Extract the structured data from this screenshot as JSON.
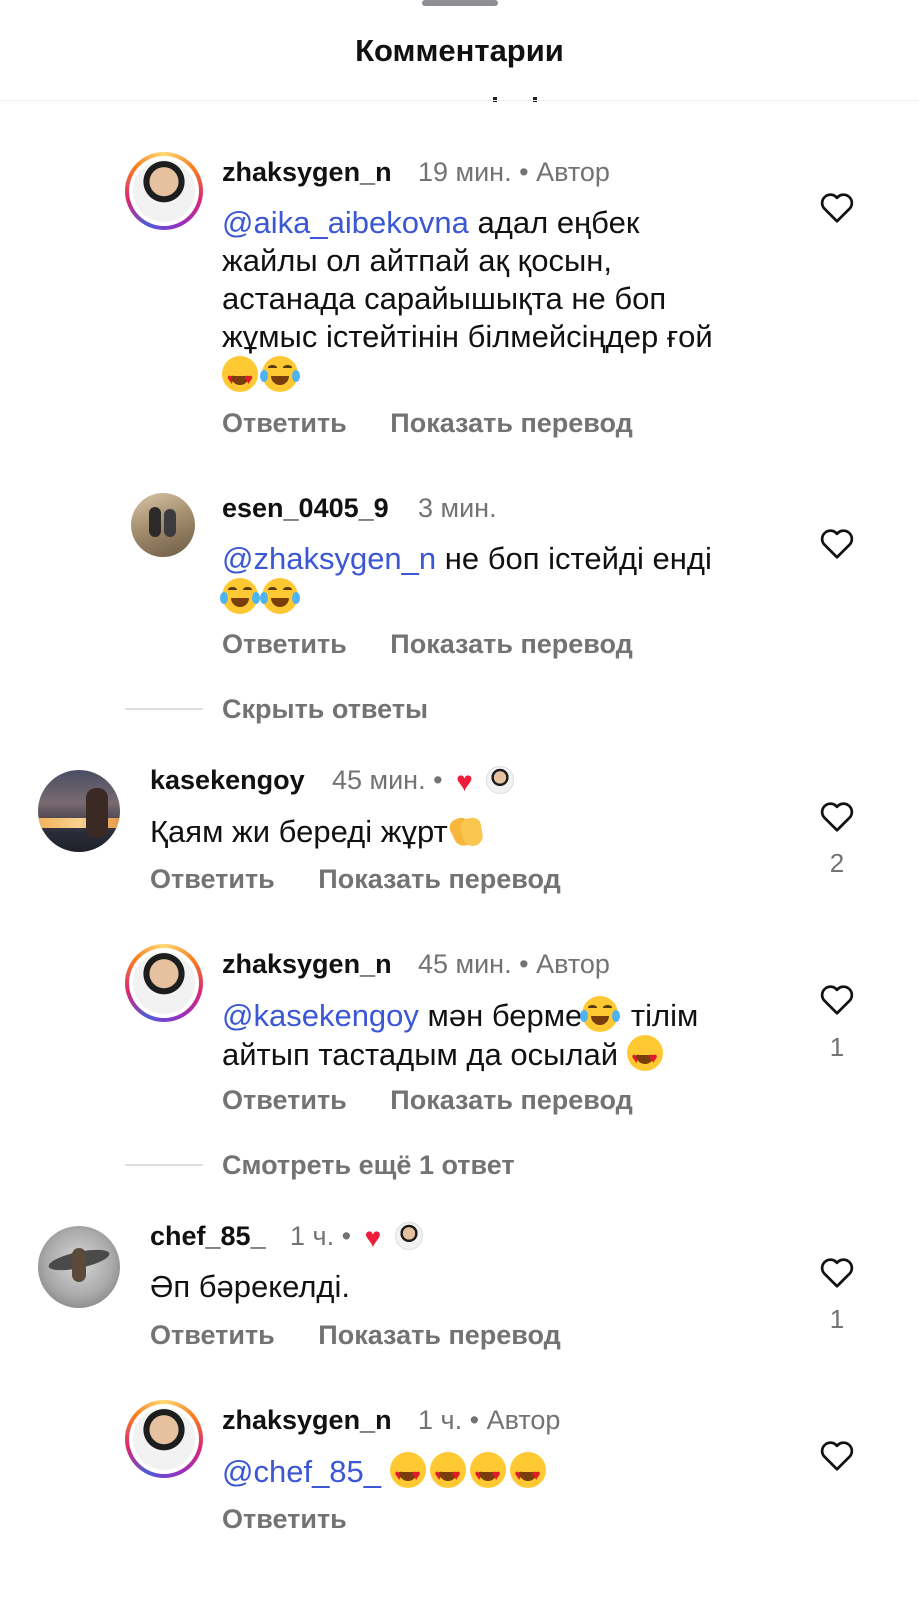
{
  "header": {
    "title": "Комментарии"
  },
  "threads": [
    {
      "username": "zhaksygen_n",
      "time": "19 мин.",
      "author_tag": "• Автор",
      "mention": "@aika_aibekovna",
      "text_lines": [
        "адал еңбек",
        "жайлы ол айтпай ақ қосын,",
        "астанада сарайышықта не боп",
        "жұмыс істейтінін білмейсіңдер ғой"
      ],
      "emoji": [
        "heart-eyes",
        "joy"
      ],
      "reply_label": "Ответить",
      "translate_label": "Показать перевод",
      "like_count": ""
    },
    {
      "username": "esen_0405_9",
      "time": "3 мин.",
      "mention": "@zhaksygen_n",
      "text_lines": [
        "не боп істейді  енді"
      ],
      "emoji": [
        "joy",
        "joy"
      ],
      "reply_label": "Ответить",
      "translate_label": "Показать перевод",
      "like_count": ""
    },
    {
      "divider_label": "Скрыть ответы"
    },
    {
      "username": "kasekengoy",
      "time": "45 мин. •",
      "text_lines": [
        "Қаям жи береді жұрт"
      ],
      "emoji": [
        "clap"
      ],
      "reply_label": "Ответить",
      "translate_label": "Показать перевод",
      "like_count": "2"
    },
    {
      "username": "zhaksygen_n",
      "time": "45 мин.",
      "author_tag": "• Автор",
      "mention": "@kasekengoy",
      "text_lines": [
        "мән берме",
        "тілім",
        "айтып тастадым да осылай"
      ],
      "emoji": [
        "joy",
        "heart-eyes"
      ],
      "reply_label": "Ответить",
      "translate_label": "Показать перевод",
      "like_count": "1"
    },
    {
      "divider_label": "Смотреть ещё 1 ответ"
    },
    {
      "username": "chef_85_",
      "time": "1 ч. •",
      "text_lines": [
        "Әп бәрекелді."
      ],
      "reply_label": "Ответить",
      "translate_label": "Показать перевод",
      "like_count": "1"
    },
    {
      "username": "zhaksygen_n",
      "time": "1 ч.",
      "author_tag": "• Автор",
      "mention": "@chef_85_",
      "emoji": [
        "heart-eyes",
        "heart-eyes",
        "heart-eyes",
        "heart-eyes"
      ],
      "reply_label": "Ответить",
      "like_count": ""
    }
  ],
  "colors": {
    "mention": "#3b57d4",
    "muted": "#737373",
    "like_heart": "#ee1c3b"
  }
}
